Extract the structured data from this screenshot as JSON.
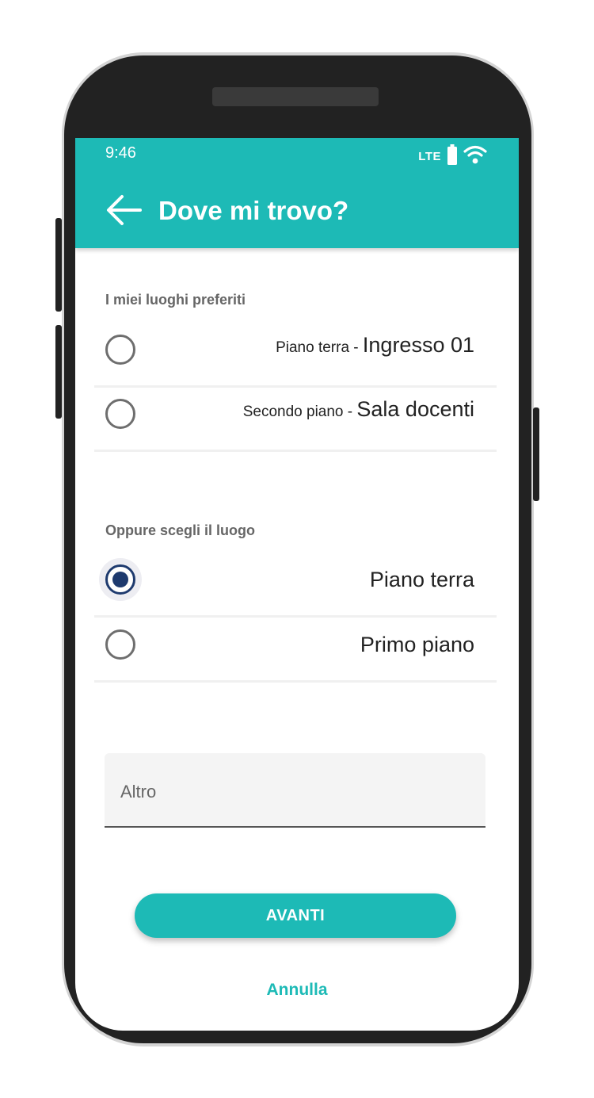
{
  "status_bar": {
    "time": "9:46",
    "network": "LTE",
    "battery_icon": "battery-icon",
    "wifi_icon": "wifi-icon"
  },
  "header": {
    "title": "Dove mi trovo?",
    "back_icon": "arrow-back-icon",
    "color": "#1dbab6"
  },
  "favorites": {
    "label": "I miei luoghi preferiti",
    "items": [
      {
        "prefix": "Piano terra - ",
        "name": "Ingresso 01",
        "selected": false
      },
      {
        "prefix": "Secondo piano - ",
        "name": "Sala docenti",
        "selected": false
      }
    ]
  },
  "places": {
    "label": "Oppure scegli il luogo",
    "items": [
      {
        "name": "Piano terra",
        "selected": true
      },
      {
        "name": "Primo piano",
        "selected": false
      }
    ]
  },
  "other_field": {
    "value": "",
    "placeholder": "Altro"
  },
  "actions": {
    "next_label": "AVANTI",
    "cancel_label": "Annulla"
  },
  "colors": {
    "accent": "#1dbab6",
    "radio_selected": "#1e3a6e"
  }
}
